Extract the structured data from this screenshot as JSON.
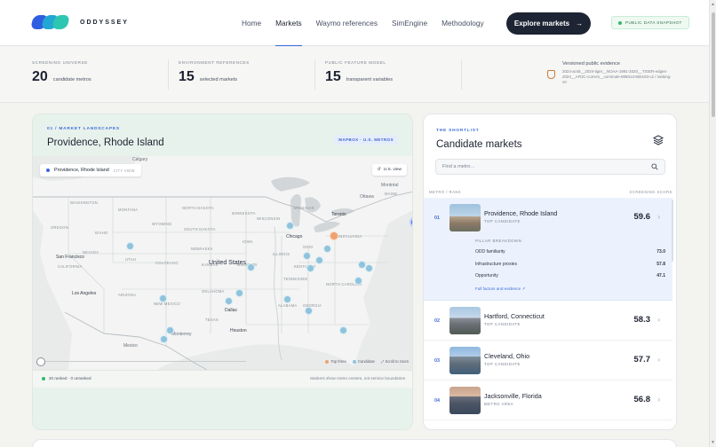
{
  "brand": {
    "name": "ODDYSSEY"
  },
  "nav": {
    "items": [
      {
        "label": "Home",
        "active": false
      },
      {
        "label": "Markets",
        "active": true
      },
      {
        "label": "Waymo references",
        "active": false
      },
      {
        "label": "SimEngine",
        "active": false
      },
      {
        "label": "Methodology",
        "active": false
      }
    ],
    "cta_label": "Explore markets",
    "cta_arrow": "→",
    "snapshot_badge": "PUBLIC DATA SNAPSHOT"
  },
  "stats": [
    {
      "caption": "SCREENING UNIVERSE",
      "value": "20",
      "label": "candidate metros"
    },
    {
      "caption": "ENVIRONMENT REFERENCES",
      "value": "15",
      "label": "selected markets"
    },
    {
      "caption": "PUBLIC FEATURE MODEL",
      "value": "15",
      "label": "transparent variables"
    }
  ],
  "evidence": {
    "title": "Versioned public evidence",
    "text": "2024-acs5__2024-tiger__NOAA-1991-2020__TIGER-edges-2024__AFDC-current__commute-806013-806103-c2 / ranking-v0"
  },
  "map_panel": {
    "kicker": "01 / MARKET LANDSCAPES",
    "title": "Providence, Rhode Island",
    "badge": "MAPBOX · U.S. METROS",
    "chip_label": "Providence, Rhode Island",
    "chip_sub": "CITY VIEW",
    "us_view": "U.S. view",
    "legend": {
      "top_three": "Top three",
      "candidate": "Candidate",
      "scroll_hint": "Scroll to zoom"
    },
    "footer_left": "20 ranked · 0 unranked",
    "footer_right": "Markers show metro centers, not service boundaries",
    "colors": {
      "selected": "#3b66e6",
      "top_three": "#f0a070",
      "candidate": "#8fc3dc"
    },
    "labels": {
      "countries": [
        "United States"
      ],
      "cities": [
        "Calgary",
        "Chicago",
        "Toronto",
        "Ottawa",
        "Montréal",
        "San Francisco",
        "Los Angeles",
        "Dallas",
        "Houston",
        "Monterrey",
        "Mexico"
      ],
      "states": [
        "WASHINGTON",
        "MONTANA",
        "NORTH DAKOTA",
        "MINNESOTA",
        "OREGON",
        "IDAHO",
        "WYOMING",
        "SOUTH DAKOTA",
        "NEBRASKA",
        "IOWA",
        "NEVADA",
        "UTAH",
        "COLORADO",
        "KANSAS",
        "MISSOURI",
        "ILLINOIS",
        "OHIO",
        "CALIFORNIA",
        "ARIZONA",
        "NEW MEXICO",
        "OKLAHOMA",
        "TEXAS",
        "ALABAMA",
        "GEORGIA",
        "TENNESSEE",
        "KENTUCKY",
        "NORTH CAROLINA",
        "PENNSYLVANIA",
        "MICHIGAN",
        "WISCONSIN",
        "MAINE"
      ]
    }
  },
  "shortlist": {
    "kicker": "THE SHORTLIST",
    "title": "Candidate markets",
    "search_placeholder": "Find a metro…",
    "col_left": "METRO / RANK",
    "col_right": "SCREENING SCORE",
    "items": [
      {
        "rank": "01",
        "name": "Providence, Rhode Island",
        "tag": "TOP CANDIDATE",
        "score": "59.6",
        "selected": true
      },
      {
        "rank": "02",
        "name": "Hartford, Connecticut",
        "tag": "TOP CANDIDATE",
        "score": "58.3",
        "selected": false
      },
      {
        "rank": "03",
        "name": "Cleveland, Ohio",
        "tag": "TOP CANDIDATE",
        "score": "57.7",
        "selected": false
      },
      {
        "rank": "04",
        "name": "Jacksonville, Florida",
        "tag": "METRO AREA",
        "score": "56.8",
        "selected": false
      }
    ],
    "breakdown": {
      "header": "PILLAR BREAKDOWN",
      "rows": [
        {
          "label": "ODD familiarity",
          "value": "73.0"
        },
        {
          "label": "Infrastructure proxies",
          "value": "57.8"
        },
        {
          "label": "Opportunity",
          "value": "47.1"
        }
      ],
      "link": "Full factors and evidence"
    }
  }
}
